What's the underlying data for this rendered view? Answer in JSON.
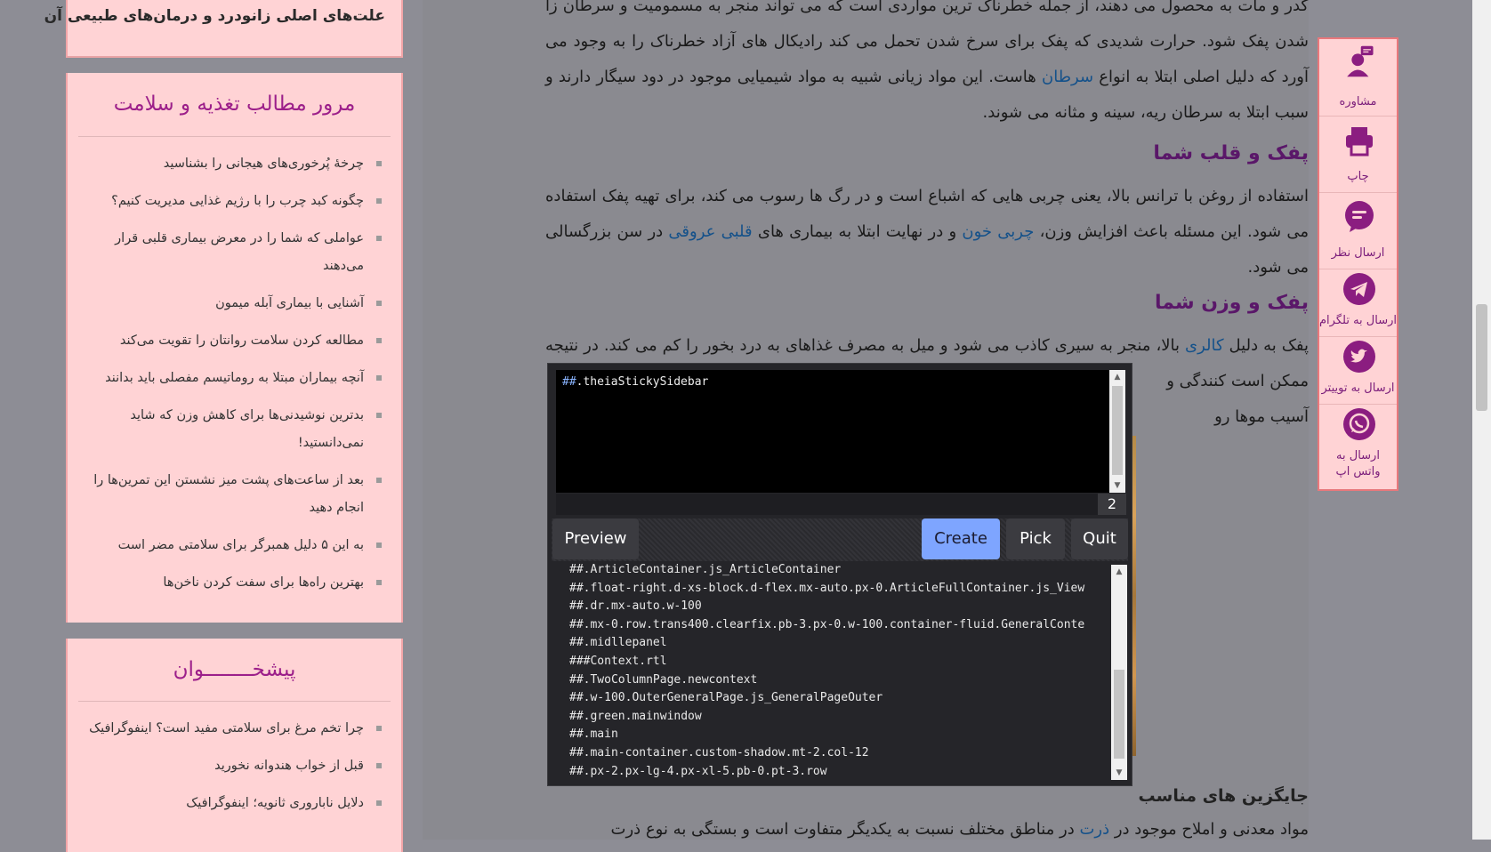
{
  "sidebar": {
    "top_title": "علت‌های اصلی زانودرد و درمان‌های طبیعی آن",
    "review": {
      "title": "مرور مطالب تغذیه و سلامت",
      "items": [
        "چرخهٔ پُرخوری‌های هیجانی را بشناسید",
        "چگونه کبد چرب را با رژیم غذایی مدیریت کنیم؟",
        "عواملی که شما را در معرض بیماری قلبی قرار می‌دهند",
        "آشنایی با بیماری آبله میمون",
        "مطالعه کردن سلامت روانتان را تقویت می‌کند",
        "آنچه بیماران مبتلا به روماتیسم مفصلی باید بدانند",
        "بدترین نوشیدنی‌ها برای کاهش وزن که شاید نمی‌دانستید!",
        "بعد از ساعت‌های پشت میز نشستن این تمرین‌ها را انجام دهید",
        "به این ۵ دلیل همبرگر برای سلامتی مضر است",
        "بهترین راه‌ها برای سفت کردن ناخن‌ها"
      ]
    },
    "suggested": {
      "title": "پیشخــــــــوان",
      "items": [
        "چرا تخم مرغ برای سلامتی مفید است؟ اینفوگرافیک",
        "قبل از خواب هندوانه نخورید",
        "دلایل ناباروری ثانویه؛ اینفوگرافیک"
      ]
    }
  },
  "article": {
    "p1": [
      "کدر و مات به محصول می دهند، از جمله خطرناک ترین مواردی است که می تواند منجر به مسمومیت و سرطان زا شدن پفک شود. حرارت شدیدی که پفک برای سرخ شدن تحمل می کند رادیکال های آزاد خطرناک را به وجود می آورد که دلیل اصلی ابتلا به انواع ",
      "سرطان",
      " هاست. این مواد زیانی شبیه به مواد شیمیایی موجود در دود سیگار دارند و سبب ابتلا به سرطان ریه، سینه و مثانه می شوند."
    ],
    "h1": "پفک و قلب شما",
    "p2": [
      "استفاده از روغن با ترانس بالا، یعنی چربی هایی که اشباع است و در رگ ها رسوب می کند، برای تهیه پفک استفاده می شود. این مسئله باعث افزایش وزن، ",
      "چربی خون",
      " و در نهایت ابتلا به بیماری های ",
      "قلبی عروقی",
      " در سن بزرگسالی می شود."
    ],
    "h2": "پفک و وزن شما",
    "p3": [
      "پفک به دلیل ",
      "کالری",
      " بالا، منجر به سیری کاذب می شود و میل به مصرف غذاهای به درد بخور را کم می کند. در نتیجه ممکن است",
      " کنندگی و",
      " آسیب موها رو"
    ],
    "h3": "جایگزین های مناسب",
    "p4": [
      "مواد معدنی و املاح موجود در ",
      "ذرت",
      " در مناطق مختلف نسبت به یکدیگر متفاوت است و بستگی به نوع ذرت"
    ]
  },
  "share": [
    {
      "icon": "consult-icon",
      "label": "مشاوره"
    },
    {
      "icon": "print-icon",
      "label": "چاپ"
    },
    {
      "icon": "comment-icon",
      "label": "ارسال نظر"
    },
    {
      "icon": "telegram-icon",
      "label": "ارسال به تلگرام"
    },
    {
      "icon": "twitter-icon",
      "label": "ارسال به توییتر"
    },
    {
      "icon": "whatsapp-icon",
      "label": "ارسال به واتس اپ"
    }
  ],
  "picker": {
    "editor_hash": "##",
    "editor_text": ".theiaStickySidebar",
    "count": "2",
    "buttons": {
      "preview": "Preview",
      "create": "Create",
      "pick": "Pick",
      "quit": "Quit"
    },
    "candidates": [
      "##.ArticleContainer.js_ArticleContainer",
      "##.float-right.d-xs-block.d-flex.mx-auto.px-0.ArticleFullContainer.js_View",
      "##.dr.mx-auto.w-100",
      "##.mx-0.row.trans400.clearfix.pb-3.px-0.w-100.container-fluid.GeneralConte",
      "##.midllepanel",
      "###Context.rtl",
      "##.TwoColumnPage.newcontext",
      "##.w-100.OuterGeneralPage.js_GeneralPageOuter",
      "##.green.mainwindow",
      "##.main",
      "##.main-container.custom-shadow.mt-2.col-12",
      "##.px-2.px-lg-4.px-xl-5.pb-0.pt-3.row"
    ]
  },
  "colors": {
    "accent": "#9c1f8a",
    "sidebar_bg": "#ffd3d5",
    "create_btn": "#7ea5ff",
    "link": "#14518a"
  }
}
